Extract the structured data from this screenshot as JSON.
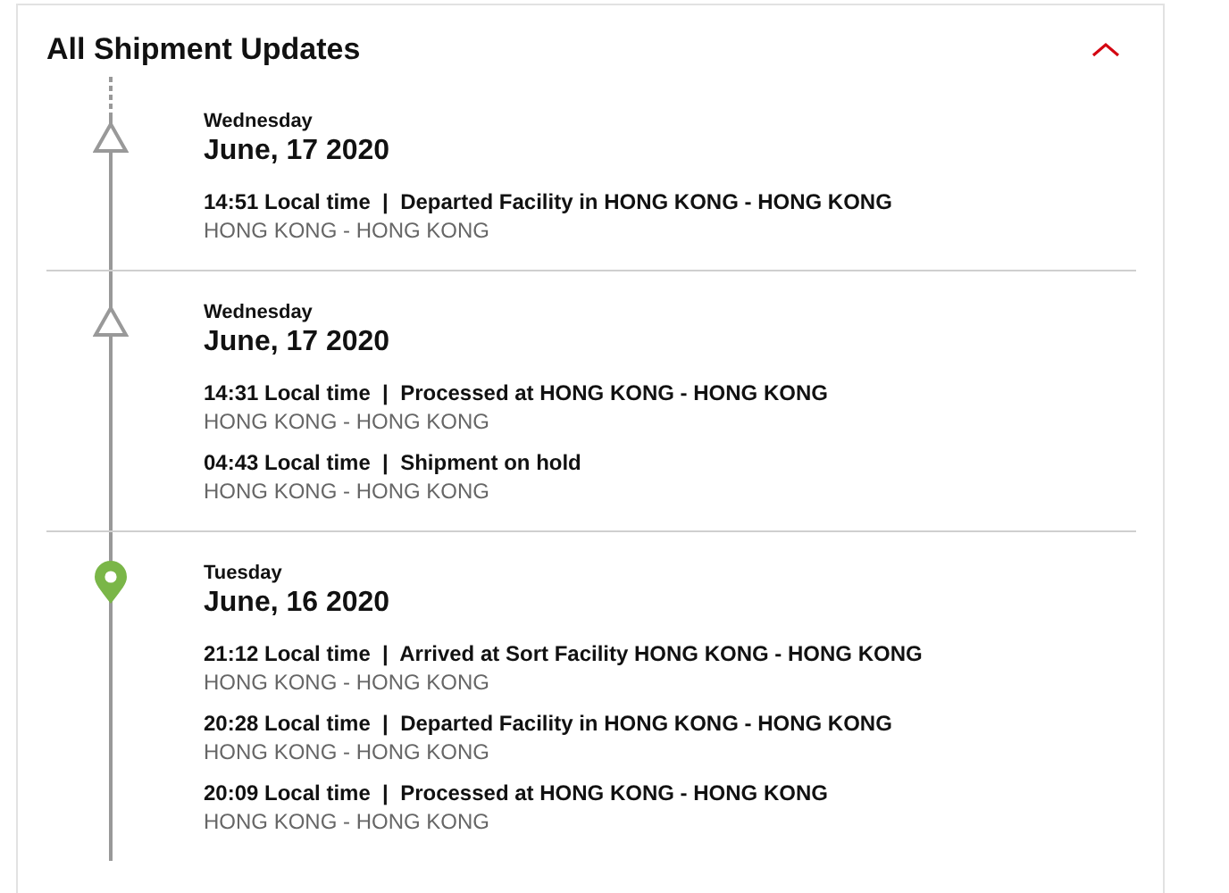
{
  "title": "All Shipment Updates",
  "expanded": true,
  "groups": [
    {
      "kind": "triangle",
      "weekday": "Wednesday",
      "date": "June, 17 2020",
      "events": [
        {
          "summary": "14:51 Local time  |  Departed Facility in HONG KONG - HONG KONG",
          "location": "HONG KONG - HONG KONG"
        }
      ]
    },
    {
      "kind": "triangle",
      "weekday": "Wednesday",
      "date": "June, 17 2020",
      "events": [
        {
          "summary": "14:31 Local time  |  Processed at HONG KONG - HONG KONG",
          "location": "HONG KONG - HONG KONG"
        },
        {
          "summary": "04:43 Local time  |  Shipment on hold",
          "location": "HONG KONG - HONG KONG"
        }
      ]
    },
    {
      "kind": "pin",
      "weekday": "Tuesday",
      "date": "June, 16 2020",
      "events": [
        {
          "summary": "21:12 Local time  |  Arrived at Sort Facility HONG KONG - HONG KONG",
          "location": "HONG KONG - HONG KONG"
        },
        {
          "summary": "20:28 Local time  |  Departed Facility in HONG KONG - HONG KONG",
          "location": "HONG KONG - HONG KONG"
        },
        {
          "summary": "20:09 Local time  |  Processed at HONG KONG - HONG KONG",
          "location": "HONG KONG - HONG KONG"
        }
      ]
    }
  ]
}
